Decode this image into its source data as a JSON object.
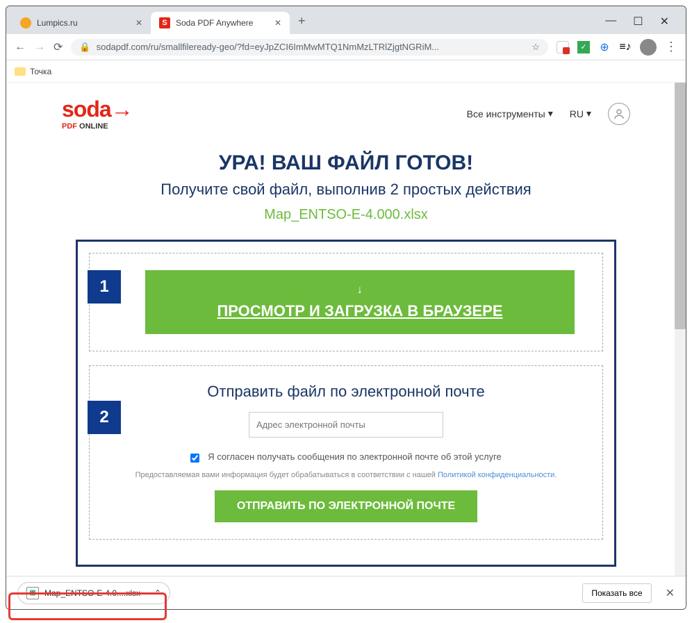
{
  "tabs": [
    {
      "title": "Lumpics.ru"
    },
    {
      "title": "Soda PDF Anywhere",
      "favicon_letter": "S"
    }
  ],
  "address": {
    "url": "sodapdf.com/ru/smallfileready-geo/?fd=eyJpZCI6ImMwMTQ1NmMzLTRlZjgtNGRiM..."
  },
  "bookmarks": {
    "item": "Точка"
  },
  "site": {
    "logo": "soda→",
    "logo_sub_pdf": "PDF",
    "logo_sub_online": " ONLINE",
    "nav_tools": "Все инструменты",
    "nav_lang": "RU"
  },
  "hero": {
    "title": "УРА! ВАШ ФАЙЛ ГОТОВ!",
    "subtitle": "Получите свой файл, выполнив 2 простых действия",
    "filename": "Map_ENTSO-E-4.000.xlsx"
  },
  "step1": {
    "num": "1",
    "button": "ПРОСМОТР И ЗАГРУЗКА В БРАУЗЕРЕ"
  },
  "step2": {
    "num": "2",
    "title": "Отправить файл по электронной почте",
    "placeholder": "Адрес электронной почты",
    "consent": "Я согласен получать сообщения по электронной почте об этой услуге",
    "disclaimer_pre": "Предоставляемая вами информация будет обрабатываться в соответствии с нашей ",
    "disclaimer_link": "Политикой конфиденциальности",
    "send": "ОТПРАВИТЬ ПО ЭЛЕКТРОННОЙ ПОЧТЕ"
  },
  "download": {
    "filename": "Map_ENTSO-E-4.0....xlsx",
    "show_all": "Показать все"
  }
}
